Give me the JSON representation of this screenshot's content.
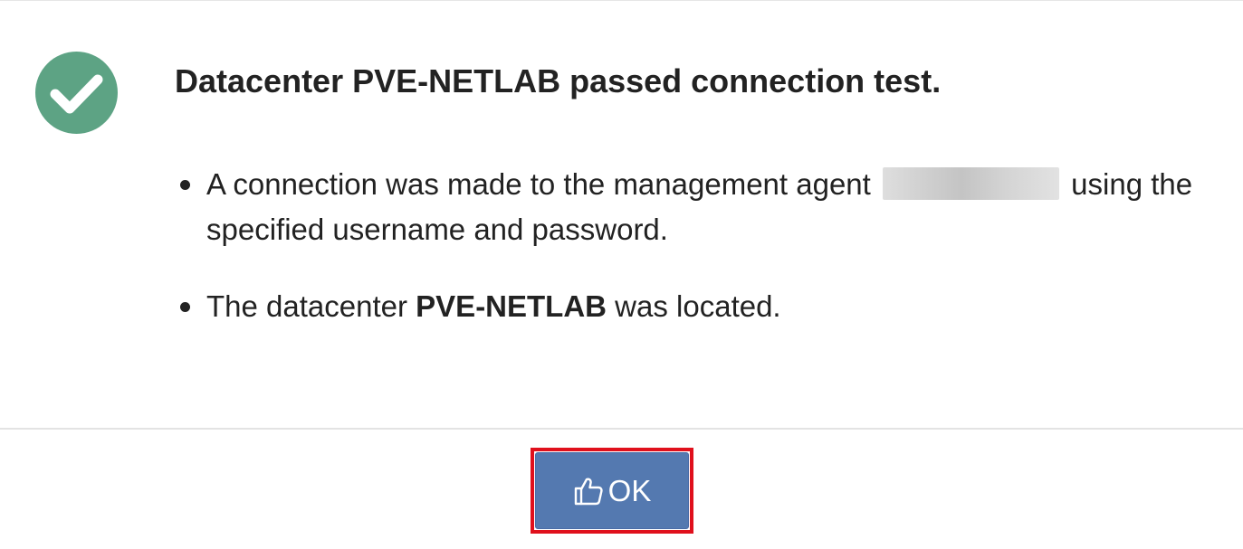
{
  "dialog": {
    "title": "Datacenter PVE-NETLAB passed connection test.",
    "status_icon": "check-circle-icon",
    "status_color": "#5da384",
    "details": [
      {
        "before_redaction": "A connection was made to the management agent",
        "after_redaction": "using the specified username and password."
      },
      {
        "before_bold": "The datacenter",
        "bold": "PVE-NETLAB",
        "after_bold": "was located."
      }
    ]
  },
  "footer": {
    "ok_label": "OK",
    "ok_icon": "thumbs-up-icon",
    "button_color": "#5479b0",
    "highlight_color": "#e0101c"
  }
}
